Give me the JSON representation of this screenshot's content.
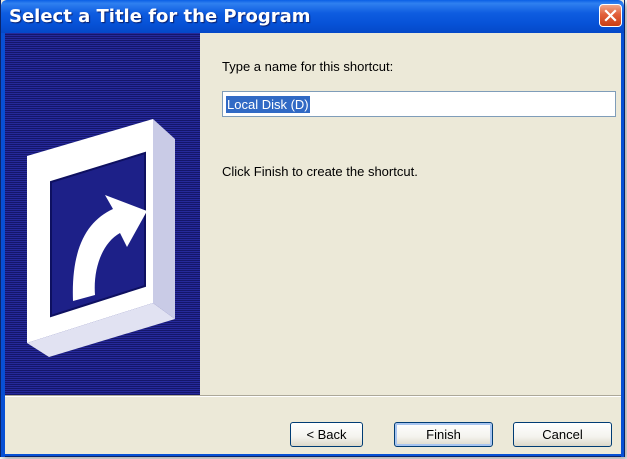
{
  "window": {
    "title": "Select a Title for the Program",
    "close_icon": "close-icon"
  },
  "colors": {
    "titlebar": "#0753d8",
    "side_panel": "#1b1d7a",
    "dialog_bg": "#ece9d8",
    "selection": "#316ac5"
  },
  "side_panel": {
    "icon": "shortcut-arrow-icon"
  },
  "form": {
    "prompt": "Type a name for this shortcut:",
    "name_value": "Local Disk (D)",
    "hint": "Click Finish to create the shortcut."
  },
  "buttons": {
    "back": "< Back",
    "finish": "Finish",
    "cancel": "Cancel"
  }
}
